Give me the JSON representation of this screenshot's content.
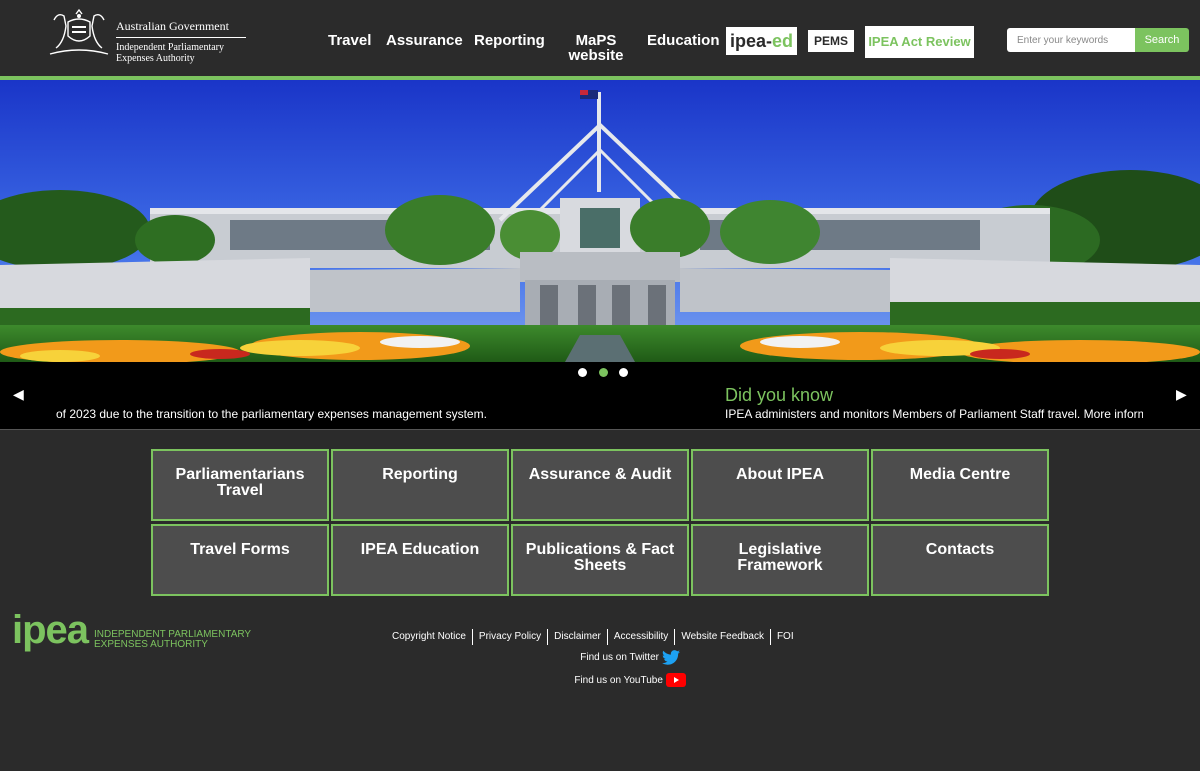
{
  "header": {
    "gov_title": "Australian Government",
    "org_line1": "Independent Parliamentary",
    "org_line2": "Expenses Authority",
    "nav": [
      {
        "label": "Travel"
      },
      {
        "label": "Assurance"
      },
      {
        "label": "Reporting"
      },
      {
        "label_line1": "MaPS",
        "label_line2": "website"
      },
      {
        "label": "Education"
      }
    ],
    "ed_logo_part1": "ipea-",
    "ed_logo_part2": "ed",
    "pems_label": "PEMS",
    "review_label": "IPEA Act Review",
    "search": {
      "placeholder": "Enter your keywords",
      "button": "Search"
    }
  },
  "carousel": {
    "left_text": "of 2023 due to the transition to the parliamentary expenses management system.",
    "right_title": "Did you know",
    "right_text": "IPEA administers and monitors Members of Parliament Staff travel. More information",
    "active_dot": 1,
    "dot_count": 3
  },
  "tiles": [
    {
      "line1": "Parliamentarians",
      "line2": "Travel"
    },
    {
      "line1": "Reporting",
      "line2": ""
    },
    {
      "line1": "Assurance & Audit",
      "line2": ""
    },
    {
      "line1": "About IPEA",
      "line2": ""
    },
    {
      "line1": "Media Centre",
      "line2": ""
    },
    {
      "line1": "Travel Forms",
      "line2": ""
    },
    {
      "line1": "IPEA Education",
      "line2": ""
    },
    {
      "line1": "Publications & Fact",
      "line2": "Sheets"
    },
    {
      "line1": "Legislative",
      "line2": "Framework"
    },
    {
      "line1": "Contacts",
      "line2": ""
    }
  ],
  "footer": {
    "logo_word": "ipea",
    "logo_line1": "INDEPENDENT PARLIAMENTARY",
    "logo_line2": "EXPENSES AUTHORITY",
    "links": [
      "Copyright Notice",
      "Privacy Policy",
      "Disclaimer",
      "Accessibility",
      "Website Feedback",
      "FOI"
    ],
    "twitter": "Find us on Twitter",
    "youtube": "Find us on YouTube"
  },
  "colors": {
    "accent": "#7cc35f",
    "background": "#2b2b2b",
    "tile": "#4d4d4d"
  }
}
